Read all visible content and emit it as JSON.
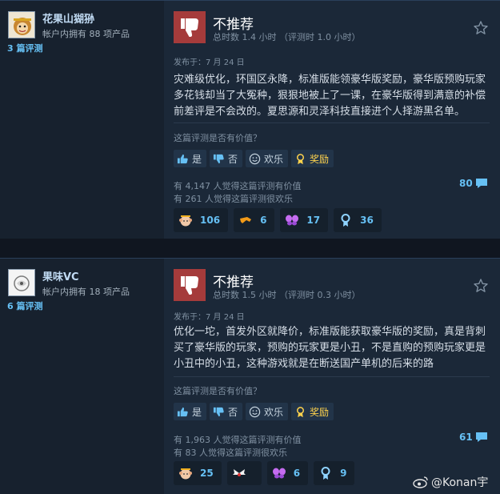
{
  "reviews": [
    {
      "user": "花果山猢狲",
      "owned": "帐户内拥有 88 项产品",
      "review_count": "3 篇评测",
      "verdict": "不推荐",
      "hours": "总时数 1.4 小时  （评测时 1.0 小时）",
      "posted": "发布于：7 月 24 日",
      "body": [
        "灾难级优化，环国区永降，标准版能领豪华版奖励，豪华版预购玩家",
        "多花钱却当了大冤种，狠狠地被上了一课，在豪华版得到满意的补偿",
        "前差评是不会改的。夏思源和灵泽科技直接进个人择游黑名单。"
      ],
      "helpful_q": "这篇评测是否有价值？",
      "buttons": {
        "yes": "是",
        "no": "否",
        "funny": "欢乐",
        "award": "奖励"
      },
      "helpful_count": "有 4,147 人觉得这篇评测有价值",
      "funny_count": "有 261 人觉得这篇评测很欢乐",
      "comments": "80",
      "awards": [
        {
          "icon": "monkey-award-icon",
          "count": "106"
        },
        {
          "icon": "hammer-award-icon",
          "count": "6"
        },
        {
          "icon": "butterfly-award-icon",
          "count": "17"
        },
        {
          "icon": "medal-award-icon",
          "count": "36"
        }
      ]
    },
    {
      "user": "果味VC",
      "owned": "帐户内拥有 18 项产品",
      "review_count": "6 篇评测",
      "verdict": "不推荐",
      "hours": "总时数 1.5 小时  （评测时 0.3 小时）",
      "posted": "发布于：7 月 24 日",
      "body": [
        "优化一坨，首发外区就降价，标准版能获取豪华版的奖励，真是背刺",
        "买了豪华版的玩家，预购的玩家更是小丑，不是直购的预购玩家更是",
        "小丑中的小丑，这种游戏就是在断送国产单机的后来的路"
      ],
      "helpful_q": "这篇评测是否有价值？",
      "buttons": {
        "yes": "是",
        "no": "否",
        "funny": "欢乐",
        "award": "奖励"
      },
      "helpful_count": "有 1,963 人觉得这篇评测有价值",
      "funny_count": "有 83 人觉得这篇评测很欢乐",
      "comments": "61",
      "awards": [
        {
          "icon": "monkey-award-icon",
          "count": "25"
        },
        {
          "icon": "wings-award-icon",
          "count": ""
        },
        {
          "icon": "butterfly-award-icon",
          "count": "6"
        },
        {
          "icon": "medal-award-icon",
          "count": "9"
        }
      ]
    }
  ],
  "watermark": "@Konan宇"
}
